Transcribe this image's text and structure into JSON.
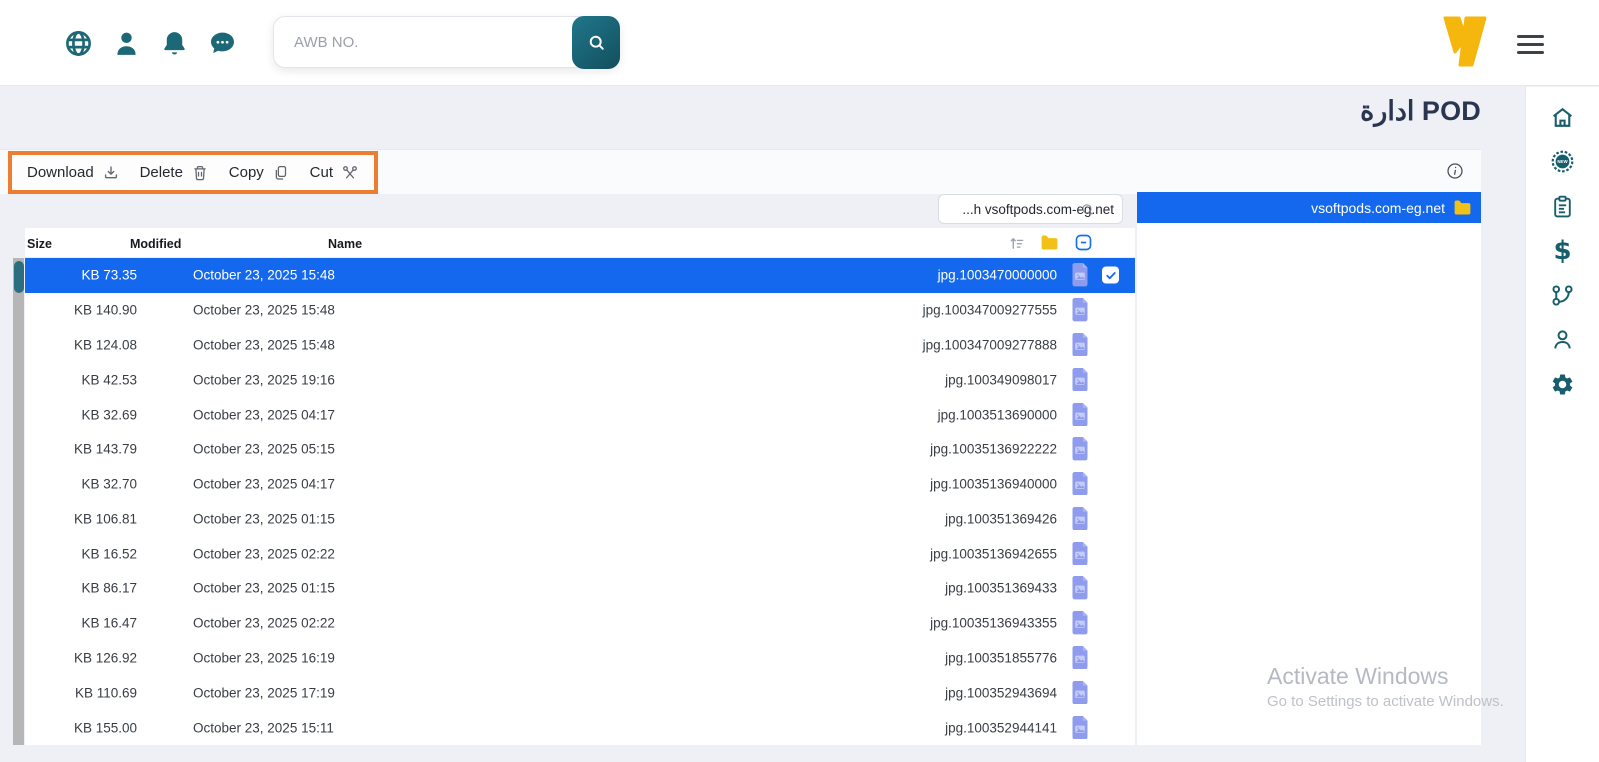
{
  "header": {
    "search": {
      "placeholder": "AWB NO."
    },
    "icons": [
      "globe-icon",
      "user-icon",
      "bell-icon",
      "chat-icon",
      "search-icon",
      "v-logo",
      "menu-icon"
    ]
  },
  "sidebar": {
    "icons": [
      "home-icon",
      "new-badge-icon",
      "clipboard-icon",
      "dollar-icon",
      "branch-icon",
      "person-icon",
      "settings-icon"
    ],
    "badge_text": "NEW"
  },
  "page": {
    "title": "ادارة POD"
  },
  "toolbar": {
    "download": "Download",
    "delete": "Delete",
    "copy": "Copy",
    "cut": "Cut"
  },
  "path_input": {
    "value": "...h vsoftpods.com-eg.net"
  },
  "tree": {
    "root_label": "vsoftpods.com-eg.net"
  },
  "table": {
    "columns": {
      "size": "Size",
      "modified": "Modified",
      "name": "Name"
    },
    "rows": [
      {
        "size": "KB 73.35",
        "modified": "October 23, 2025 15:48",
        "name": "jpg.1003470000000",
        "selected": true
      },
      {
        "size": "KB 140.90",
        "modified": "October 23, 2025 15:48",
        "name": "jpg.100347009277555",
        "selected": false
      },
      {
        "size": "KB 124.08",
        "modified": "October 23, 2025 15:48",
        "name": "jpg.100347009277888",
        "selected": false
      },
      {
        "size": "KB 42.53",
        "modified": "October 23, 2025 19:16",
        "name": "jpg.100349098017",
        "selected": false
      },
      {
        "size": "KB 32.69",
        "modified": "October 23, 2025 04:17",
        "name": "jpg.1003513690000",
        "selected": false
      },
      {
        "size": "KB 143.79",
        "modified": "October 23, 2025 05:15",
        "name": "jpg.10035136922222",
        "selected": false
      },
      {
        "size": "KB 32.70",
        "modified": "October 23, 2025 04:17",
        "name": "jpg.10035136940000",
        "selected": false
      },
      {
        "size": "KB 106.81",
        "modified": "October 23, 2025 01:15",
        "name": "jpg.100351369426",
        "selected": false
      },
      {
        "size": "KB 16.52",
        "modified": "October 23, 2025 02:22",
        "name": "jpg.10035136942655",
        "selected": false
      },
      {
        "size": "KB 86.17",
        "modified": "October 23, 2025 01:15",
        "name": "jpg.100351369433",
        "selected": false
      },
      {
        "size": "KB 16.47",
        "modified": "October 23, 2025 02:22",
        "name": "jpg.10035136943355",
        "selected": false
      },
      {
        "size": "KB 126.92",
        "modified": "October 23, 2025 16:19",
        "name": "jpg.100351855776",
        "selected": false
      },
      {
        "size": "KB 110.69",
        "modified": "October 23, 2025 17:19",
        "name": "jpg.100352943694",
        "selected": false
      },
      {
        "size": "KB 155.00",
        "modified": "October 23, 2025 15:11",
        "name": "jpg.100352944141",
        "selected": false
      }
    ]
  },
  "watermark": {
    "line1": "Activate Windows",
    "line2": "Go to Settings to activate Windows."
  },
  "colors": {
    "accent_teal": "#1d6876",
    "selection_blue": "#1468EE",
    "brand_yellow": "#F5B60D",
    "highlight_orange": "#ED7D31",
    "file_icon_purple": "#8F9CEE"
  }
}
